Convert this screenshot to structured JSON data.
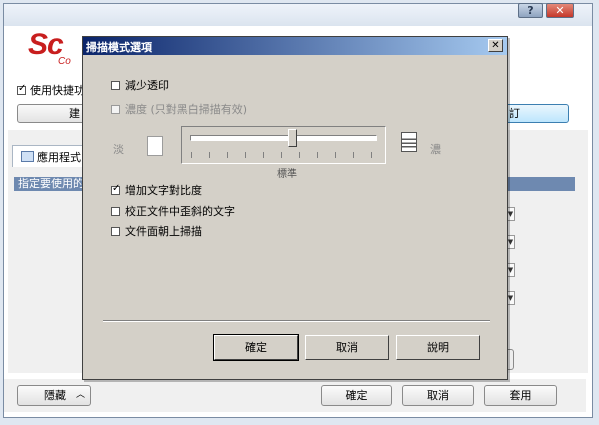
{
  "background_window": {
    "help_button_label": "?",
    "close_button_label": "✕",
    "logo_text": "Sc",
    "logo_sub_text": "Co",
    "shortcut_checkbox_label": "使用快捷功",
    "left_button_label": "建",
    "right_button_label": "訂",
    "tab_label": "應用程式",
    "bluebar_text": "指定要使用的",
    "hide_button_label": "隱藏",
    "hide_chevron": "︿",
    "ok_button_label": "確定",
    "cancel_button_label": "取消",
    "apply_button_label": "套用"
  },
  "dialog": {
    "title": "掃描模式選項",
    "close_label": "✕",
    "options": {
      "reduce_bleed_through": {
        "label": "減少透印",
        "checked": false
      },
      "density": {
        "label": "濃度 (只對黑白掃描有效)",
        "checked": false,
        "disabled": true
      },
      "increase_contrast": {
        "label": "增加文字對比度",
        "checked": true
      },
      "deskew_text": {
        "label": "校正文件中歪斜的文字",
        "checked": false
      },
      "face_up_scan": {
        "label": "文件面朝上掃描",
        "checked": false
      }
    },
    "slider": {
      "light_label": "淡",
      "dark_label": "濃",
      "standard_label": "標準",
      "value_fraction": 0.55
    },
    "buttons": {
      "ok": "確定",
      "cancel": "取消",
      "help": "說明"
    }
  }
}
